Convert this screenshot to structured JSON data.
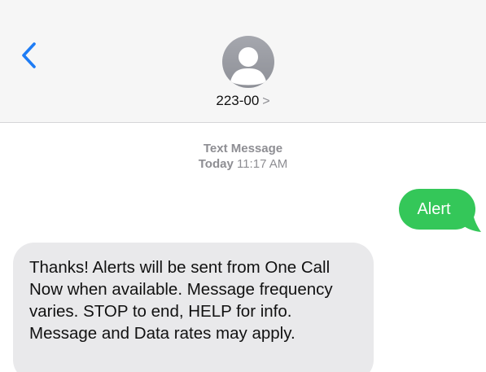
{
  "header": {
    "contact_name": "223-00",
    "contact_chevron": ">"
  },
  "icons": {
    "back": "chevron-left-icon",
    "avatar": "person-icon",
    "contact_chevron": "chevron-right-icon"
  },
  "colors": {
    "accent_blue": "#1e7cf5",
    "sent_bubble": "#34c759",
    "received_bubble": "#e9e9eb",
    "header_bg": "#f6f6f6",
    "meta_text": "#8e8e93"
  },
  "conversation": {
    "meta_type": "Text Message",
    "meta_day": "Today",
    "meta_time": "11:17 AM",
    "messages": [
      {
        "direction": "outgoing",
        "text": "Alert"
      },
      {
        "direction": "incoming",
        "text": "Thanks! Alerts will be sent from One Call Now when available. Message frequency varies. STOP to end, HELP for info. Message and Data rates may apply."
      }
    ]
  }
}
